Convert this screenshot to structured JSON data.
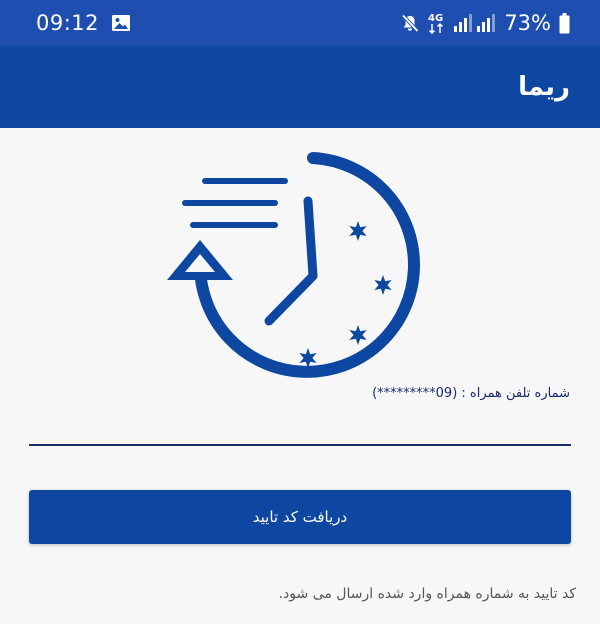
{
  "status_bar": {
    "time": "09:12",
    "battery": "73%",
    "network": "4G",
    "icons": [
      "gallery-icon",
      "mute-icon",
      "signal-icon",
      "battery-icon"
    ]
  },
  "app_bar": {
    "title": "ریما"
  },
  "form": {
    "phone_label": "شماره تلفن همراه : (09*********)",
    "phone_value": "",
    "submit_label": "دریافت کد تایید",
    "info_text": "کد تایید به شماره همراه وارد شده ارسال می شود."
  },
  "colors": {
    "status_bar": "#1e4fb0",
    "primary": "#0d47a1",
    "background": "#f7f7f7",
    "label": "#1a2a6c"
  },
  "logo": {
    "icon": "clock-history-icon"
  }
}
